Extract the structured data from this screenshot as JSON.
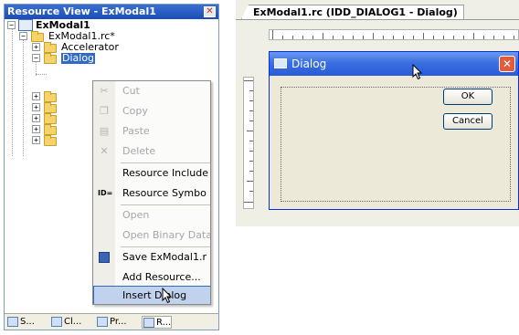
{
  "resource_view": {
    "title": "Resource View - ExModal1",
    "tree": {
      "root": "ExModal1",
      "rc_file": "ExModal1.rc*",
      "accelerator": "Accelerator",
      "selected": "Dialog"
    },
    "tabs": [
      "S...",
      "Cl...",
      "Pr...",
      "R..."
    ]
  },
  "context_menu": {
    "items": [
      {
        "label": "Cut",
        "enabled": false,
        "icon": "scissors-icon"
      },
      {
        "label": "Copy",
        "enabled": false,
        "icon": "copy-icon"
      },
      {
        "label": "Paste",
        "enabled": false,
        "icon": "paste-icon"
      },
      {
        "label": "Delete",
        "enabled": false,
        "icon": "delete-icon"
      },
      {
        "label": "Resource Include",
        "enabled": true,
        "icon": ""
      },
      {
        "label": "Resource Symbo",
        "enabled": true,
        "icon": "id-icon",
        "icon_text": "ID="
      },
      {
        "label": "Open",
        "enabled": false,
        "icon": ""
      },
      {
        "label": "Open Binary Data",
        "enabled": false,
        "icon": ""
      },
      {
        "label": "Save ExModal1.r",
        "enabled": true,
        "icon": "save-icon"
      },
      {
        "label": "Add Resource...",
        "enabled": true,
        "icon": ""
      },
      {
        "label": "Insert Dialog",
        "enabled": true,
        "icon": "",
        "selected": true
      }
    ]
  },
  "editor": {
    "tab_title": "ExModal1.rc (IDD_DIALOG1 - Dialog)",
    "dialog": {
      "title": "Dialog",
      "ok_label": "OK",
      "cancel_label": "Cancel"
    }
  },
  "colors": {
    "titlebar": "#2a5bd7",
    "menu_selection": "#c1d2ee",
    "dialog_face": "#ece9d8"
  }
}
